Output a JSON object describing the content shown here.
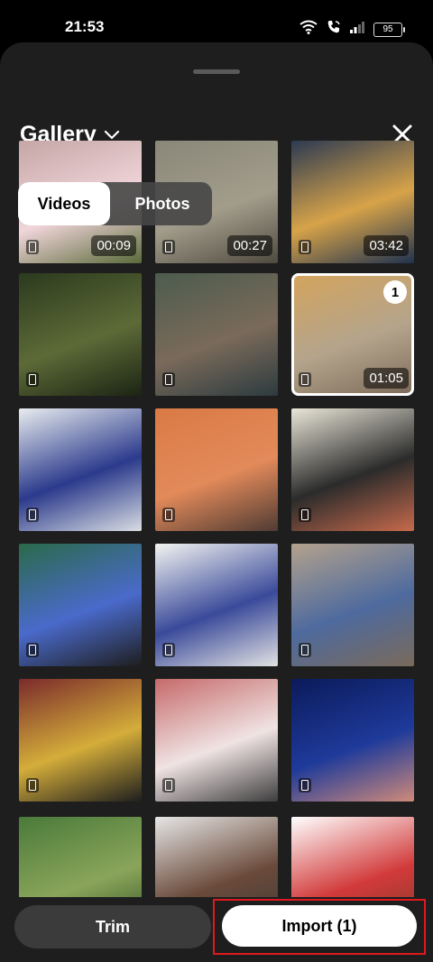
{
  "status_bar": {
    "time": "21:53",
    "battery": "95",
    "icons": [
      "wifi-icon",
      "wifi-call-icon",
      "signal-icon",
      "battery-icon"
    ]
  },
  "header": {
    "title": "Gallery",
    "dropdown_icon": "chevron-down-icon",
    "close_icon": "close-icon"
  },
  "tabs": {
    "videos": "Videos",
    "photos": "Photos",
    "active": "Videos"
  },
  "media": [
    {
      "duration": "00:09",
      "colors": [
        "#c6a6a6",
        "#f0d5d9",
        "#5a6a3a"
      ]
    },
    {
      "duration": "00:27",
      "colors": [
        "#8a8779",
        "#a29d8b",
        "#4f4a3f"
      ]
    },
    {
      "duration": "03:42",
      "colors": [
        "#2c3a52",
        "#d7a349",
        "#20324f"
      ]
    },
    {
      "duration": "",
      "colors": [
        "#2b3a1e",
        "#5d6a37",
        "#1c2414"
      ]
    },
    {
      "duration": "",
      "colors": [
        "#4c5c4e",
        "#7a6a5a",
        "#2d3b3f"
      ]
    },
    {
      "duration": "01:05",
      "colors": [
        "#d4a45c",
        "#b4a48c",
        "#7b6a58"
      ],
      "selected": true,
      "selection_index": "1"
    },
    {
      "duration": "",
      "colors": [
        "#e8ecef",
        "#2b3a8c",
        "#d9dde2"
      ]
    },
    {
      "duration": "",
      "colors": [
        "#d97a45",
        "#e38a5a",
        "#4f3b33"
      ]
    },
    {
      "duration": "",
      "colors": [
        "#eae7d8",
        "#2b2b2b",
        "#c76a4c"
      ]
    },
    {
      "duration": "",
      "colors": [
        "#2a6a4a",
        "#4a6acb",
        "#1e1e1e"
      ]
    },
    {
      "duration": "",
      "colors": [
        "#f3f4f1",
        "#3a4a9a",
        "#e2e2e2"
      ]
    },
    {
      "duration": "",
      "colors": [
        "#b3a28c",
        "#4e6a9e",
        "#7a6a5a"
      ]
    },
    {
      "duration": "",
      "colors": [
        "#7a2b2b",
        "#d4ad3a",
        "#1e1e1e"
      ]
    },
    {
      "duration": "",
      "colors": [
        "#c66a6a",
        "#f0e3e3",
        "#3d3d3d"
      ]
    },
    {
      "duration": "",
      "colors": [
        "#0b1a5a",
        "#1e3a9a",
        "#d08a7a"
      ]
    },
    {
      "duration": "",
      "colors": [
        "#4a7a3a",
        "#8aa55a",
        "#2d4a1f"
      ]
    },
    {
      "duration": "",
      "colors": [
        "#e6e6e6",
        "#6a4a3a",
        "#3a3a3a"
      ]
    },
    {
      "duration": "",
      "colors": [
        "#ffffff",
        "#d23a3a",
        "#7a3a2a"
      ]
    }
  ],
  "actions": {
    "trim": "Trim",
    "import": "Import (1)"
  },
  "colors": {
    "sheet": "#1e1e1e",
    "highlight_border": "#e0191e",
    "import_bg": "#ffffff",
    "trim_bg": "#3b3b3b"
  }
}
